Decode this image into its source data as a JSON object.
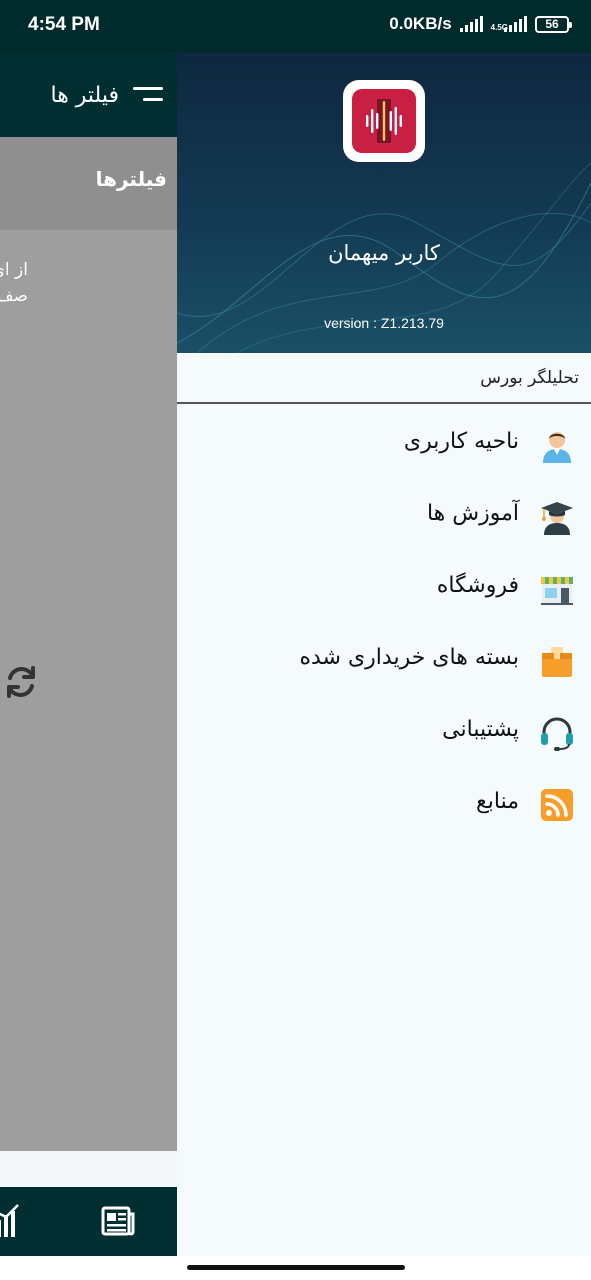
{
  "status_bar": {
    "time": "4:54 PM",
    "network_speed": "0.0KB/s",
    "network_type": "4.5G",
    "battery": "56"
  },
  "background_app": {
    "toolbar_title": "فیلتر ها",
    "section_title": "فیلترها",
    "content_line1": "از ای",
    "content_line2": "صف",
    "menu_icon": "hamburger-menu-icon",
    "refresh_icon": "refresh-icon",
    "bottom_nav_icons": [
      "chart-icon",
      "news-icon"
    ]
  },
  "drawer": {
    "user_name": "کاربر میهمان",
    "version": "version : Z1.213.79",
    "subtitle": "تحلیلگر بورس",
    "colors": {
      "header_dark": "#0f2740",
      "logo_red": "#c81f43",
      "status_bar": "#002a2c"
    },
    "menu_items": [
      {
        "label": "ناحیه کاربری",
        "icon": "user-icon"
      },
      {
        "label": "آموزش ها",
        "icon": "graduate-icon"
      },
      {
        "label": "فروشگاه",
        "icon": "store-icon"
      },
      {
        "label": "بسته های خریداری شده",
        "icon": "package-icon"
      },
      {
        "label": "پشتیبانی",
        "icon": "headset-icon"
      },
      {
        "label": "منابع",
        "icon": "rss-icon"
      }
    ]
  }
}
